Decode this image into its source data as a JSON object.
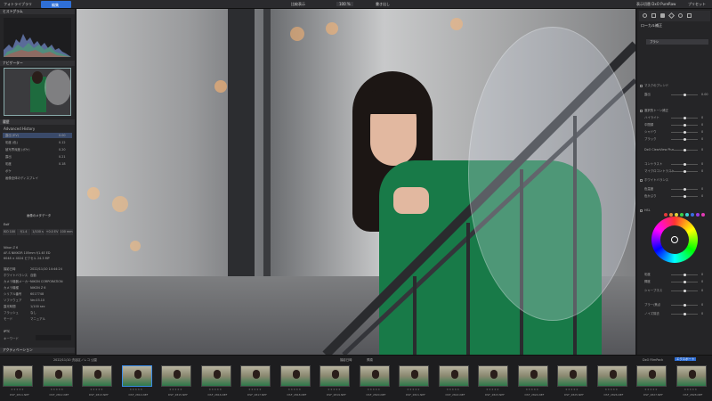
{
  "topbar": {
    "app_tab": "フォトライブラリ",
    "mode_tab": "編集",
    "compare_label": "比較表示",
    "zoom_value": "100 %",
    "export_menu": "書き出し",
    "right_tab1": "表示切替 DxO PureRaw",
    "right_tab2": "プリセット"
  },
  "left_panel": {
    "histogram_title": "ヒストグラム",
    "navigator_title": "ナビゲーター",
    "history_title": "履歴",
    "history_subtitle": "Advanced History",
    "history_items": [
      "露出 (EV)",
      "彩度 (色)",
      "被写界深度 (ボケ)",
      "露出",
      "彩度",
      "ボケ",
      "画像全体のディスプレイ"
    ],
    "history_values": [
      "0.00",
      "0.12",
      "0.20",
      "0.21",
      "0.18",
      ""
    ],
    "metadata_title": "画像のメタデータ",
    "exif_label": "Exif",
    "exif_stats": [
      "ISO 100",
      "f/1.4",
      "1/100 s",
      "+0.0 EV",
      "100 mm"
    ],
    "camera": "Nikon Z 6",
    "lens": "AF-S NIKKOR 105mm f/1.4E ED",
    "dimensions": "6048 × 4024 ピクセル 24.3 MP",
    "info_rows": [
      {
        "k": "撮影日時",
        "v": "2022/11/10 14:44:24"
      },
      {
        "k": "ホワイトバランス",
        "v": "自動"
      },
      {
        "k": "カメラ機器メーカー",
        "v": "NIKON CORPORATION"
      },
      {
        "k": "カメラ機種",
        "v": "NIKON Z 6"
      },
      {
        "k": "シリアル番号",
        "v": "6017748"
      },
      {
        "k": "ソフトウェア",
        "v": "Ver.03.10"
      },
      {
        "k": "露光時間",
        "v": "1/100 sec"
      },
      {
        "k": "フラッシュ",
        "v": "なし"
      },
      {
        "k": "モード",
        "v": "マニュアル"
      }
    ],
    "iptc_title": "IPTC",
    "keywords_label": "キーワード",
    "footer_title": "アクティベーション"
  },
  "right_panel": {
    "top_icons_label": "ローカル補正",
    "search_label": "ブラシ",
    "sections": [
      {
        "label": "マスクのブレンド",
        "value": ""
      },
      {
        "label": "露出",
        "value": "0.00"
      },
      {
        "label": "選択的トーン補正",
        "value": ""
      },
      {
        "label": "ハイライト",
        "value": "0"
      },
      {
        "label": "中間調",
        "value": "0"
      },
      {
        "label": "シャドウ",
        "value": "0"
      },
      {
        "label": "ブラック",
        "value": "0"
      },
      {
        "label": "DxO ClearView Plus",
        "value": "0"
      },
      {
        "label": "コントラスト",
        "value": "0"
      },
      {
        "label": "マイクロコントラスト",
        "value": "0"
      },
      {
        "label": "ホワイトバランス",
        "value": ""
      },
      {
        "label": "色温度",
        "value": "0"
      },
      {
        "label": "色かぶり",
        "value": "0"
      },
      {
        "label": "HSL",
        "value": ""
      },
      {
        "label": "彩度",
        "value": "0"
      },
      {
        "label": "輝度",
        "value": "0"
      },
      {
        "label": "シャープネス",
        "value": "0"
      },
      {
        "label": "ブラー/焦点",
        "value": "0"
      },
      {
        "label": "ノイズ除去",
        "value": "0"
      }
    ],
    "swatch_colors": [
      "#e23a3a",
      "#e2903a",
      "#e2d43a",
      "#3ad24a",
      "#3ad2d2",
      "#3a6ee2",
      "#9a3ae2",
      "#e23ab4"
    ]
  },
  "filmstrip": {
    "path_label": "2022/11/10 渋谷区ノレコ 公園",
    "sort_label": "撮影日時",
    "sort_order": "昇順",
    "collection_label": "DxO FilmPack",
    "export_button": "エクスポート",
    "items": [
      "DSF_2811.NEF",
      "DSF_2812.NEF",
      "DSF_2813.NEF",
      "DSF_2814.NEF",
      "DSF_2815.NEF",
      "DSF_2816.NEF",
      "DSF_2817.NEF",
      "DSF_2818.NEF",
      "DSF_2819.NEF",
      "DSF_2820.NEF",
      "DSF_2821.NEF",
      "DSF_2822.NEF",
      "DSF_2823.NEF",
      "DSF_2824.NEF",
      "DSF_2825.NEF",
      "DSF_2826.NEF",
      "DSF_2827.NEF",
      "DSF_2828.NEF"
    ],
    "selected_index": 3
  }
}
